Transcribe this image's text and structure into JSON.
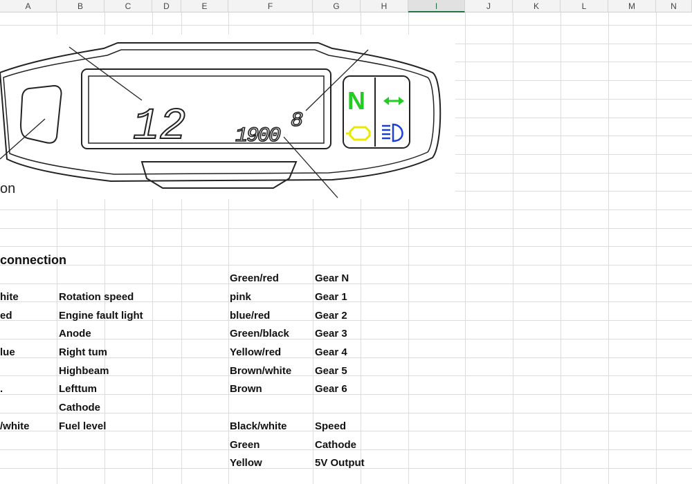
{
  "columns": [
    "A",
    "B",
    "C",
    "D",
    "E",
    "F",
    "G",
    "H",
    "I",
    "J",
    "K",
    "L",
    "M",
    "N"
  ],
  "selected_column": "I",
  "image": {
    "caption": "on",
    "gear_display": "12",
    "odometer_display": "1900",
    "small_digit": "8",
    "indicator_n": "N",
    "colors": {
      "neutral": "#22cc22",
      "turn": "#22cc22",
      "engine": "#e8e800",
      "highbeam": "#1a3fd6"
    },
    "icons": [
      "neutral-indicator-icon",
      "turn-signal-icon",
      "engine-fault-icon",
      "high-beam-icon"
    ]
  },
  "section_title": "connection",
  "left_table": [
    {
      "wire": "hite",
      "function": "Rotation speed"
    },
    {
      "wire": "ed",
      "function": "Engine fault light"
    },
    {
      "wire": "",
      "function": "Anode"
    },
    {
      "wire": "lue",
      "function": "Right tum"
    },
    {
      "wire": "",
      "function": "Highbeam"
    },
    {
      "wire": ".",
      "function": "Lefttum"
    },
    {
      "wire": "",
      "function": "Cathode"
    },
    {
      "wire": "/white",
      "function": "Fuel level"
    }
  ],
  "right_table": [
    {
      "wire": "Green/red",
      "function": "Gear N"
    },
    {
      "wire": "pink",
      "function": "Gear 1"
    },
    {
      "wire": "blue/red",
      "function": "Gear 2"
    },
    {
      "wire": "Green/black",
      "function": "Gear 3"
    },
    {
      "wire": "Yellow/red",
      "function": "Gear 4"
    },
    {
      "wire": "Brown/white",
      "function": "Gear 5"
    },
    {
      "wire": "Brown",
      "function": "Gear 6"
    },
    {
      "wire": "",
      "function": ""
    },
    {
      "wire": "Black/white",
      "function": "Speed"
    },
    {
      "wire": "Green",
      "function": "Cathode"
    },
    {
      "wire": "Yellow",
      "function": "5V Output"
    }
  ]
}
